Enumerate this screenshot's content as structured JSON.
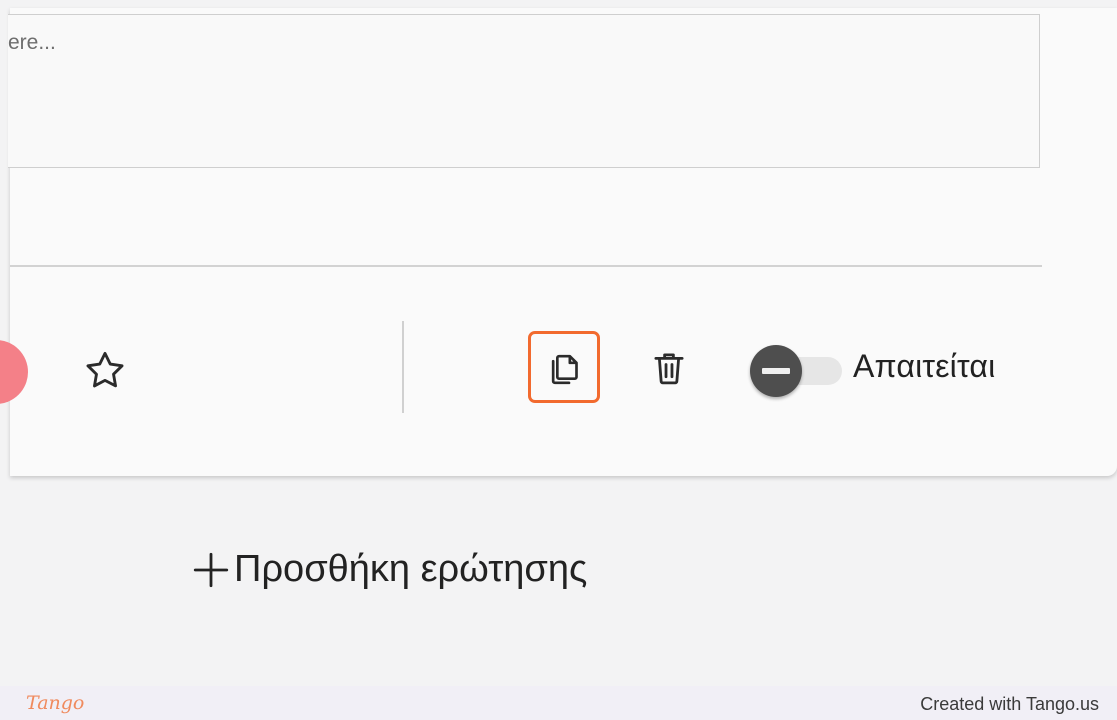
{
  "form": {
    "description_placeholder": "ere..."
  },
  "toolbar": {
    "star_icon": "star-icon",
    "copy_icon": "copy-icon",
    "delete_icon": "trash-icon",
    "required_label": "Απαιτείται",
    "required_on": false
  },
  "add_question": {
    "label": "Προσθήκη ερώτησης",
    "icon": "plus-icon"
  },
  "footer": {
    "logo": "Tango",
    "credit": "Created with Tango.us"
  },
  "colors": {
    "highlight": "#f26a2e",
    "accent_circle": "#f48088",
    "toggle_knob": "#4e4e4e"
  }
}
